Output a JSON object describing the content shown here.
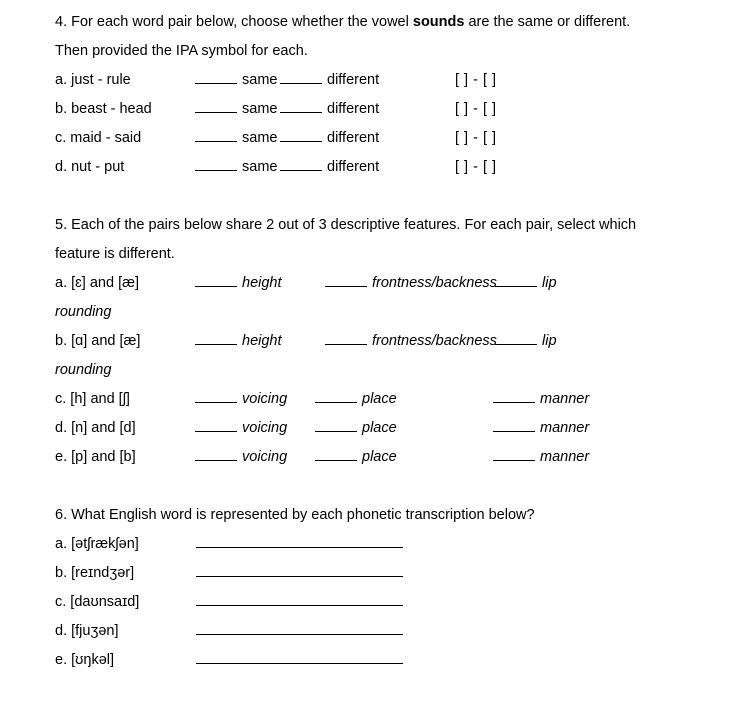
{
  "worksheet": {
    "q4": {
      "number": "4.",
      "prompt_part1": "4. For each word pair below, choose whether the vowel ",
      "prompt_bold": "sounds",
      "prompt_part2": " are the same or different.",
      "prompt_line2": "Then provided the IPA symbol for each.",
      "option_same": "same",
      "option_different": "different",
      "brackets": "[   ]  -  [   ]",
      "items": [
        {
          "label": "a. just - rule"
        },
        {
          "label": "b. beast - head"
        },
        {
          "label": "c. maid - said"
        },
        {
          "label": "d. nut - put"
        }
      ]
    },
    "q5": {
      "prompt": "5. Each of the pairs below share 2 out of 3 descriptive features. For each pair, select which feature is different.",
      "vowel_features": {
        "f1": "height",
        "f2": "frontness/backness",
        "f3": "lip",
        "f3_wrap": "rounding"
      },
      "consonant_features": {
        "f1": "voicing",
        "f2": "place",
        "f3": "manner"
      },
      "items": [
        {
          "label": "a. [ɛ] and [æ]",
          "kind": "vowel"
        },
        {
          "label": "b. [ɑ] and [æ]",
          "kind": "vowel"
        },
        {
          "label": "c. [h] and [ʃ]",
          "kind": "consonant"
        },
        {
          "label": "d. [n] and [d]",
          "kind": "consonant"
        },
        {
          "label": "e. [p] and [b]",
          "kind": "consonant"
        }
      ]
    },
    "q6": {
      "prompt": "6. What English word is represented by each phonetic transcription below?",
      "items": [
        {
          "label": "a. [ətʃrækʃən]"
        },
        {
          "label": "b. [reɪndʒər]"
        },
        {
          "label": "c. [daʊnsaɪd]"
        },
        {
          "label": "d. [fjuʒən]"
        },
        {
          "label": "e. [ʊŋkəl]"
        }
      ]
    }
  }
}
